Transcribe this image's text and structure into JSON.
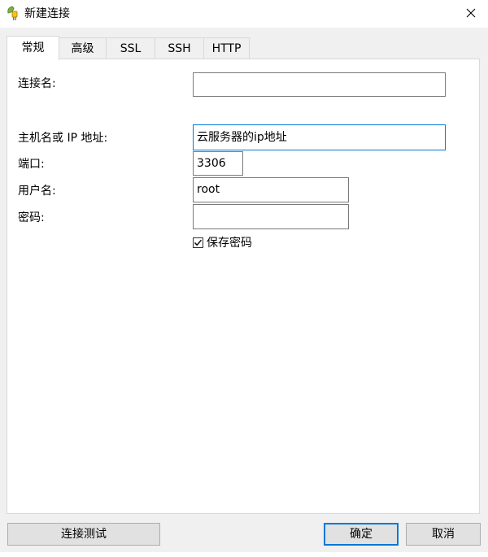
{
  "window": {
    "title": "新建连接",
    "icon": "navicat-leaf-plug-icon"
  },
  "tabs": [
    {
      "label": "常规",
      "active": true
    },
    {
      "label": "高级",
      "active": false
    },
    {
      "label": "SSL",
      "active": false
    },
    {
      "label": "SSH",
      "active": false
    },
    {
      "label": "HTTP",
      "active": false
    }
  ],
  "form": {
    "connection_name": {
      "label": "连接名:",
      "value": ""
    },
    "host": {
      "label": "主机名或 IP 地址:",
      "value": "云服务器的ip地址"
    },
    "port": {
      "label": "端口:",
      "value": "3306"
    },
    "username": {
      "label": "用户名:",
      "value": "root"
    },
    "password": {
      "label": "密码:",
      "value": ""
    },
    "save_password": {
      "label": "保存密码",
      "checked": true
    }
  },
  "buttons": {
    "test_connection": "连接测试",
    "ok": "确定",
    "cancel": "取消"
  },
  "colors": {
    "focus_border": "#0078d7",
    "dialog_background": "#f0f0f0"
  }
}
